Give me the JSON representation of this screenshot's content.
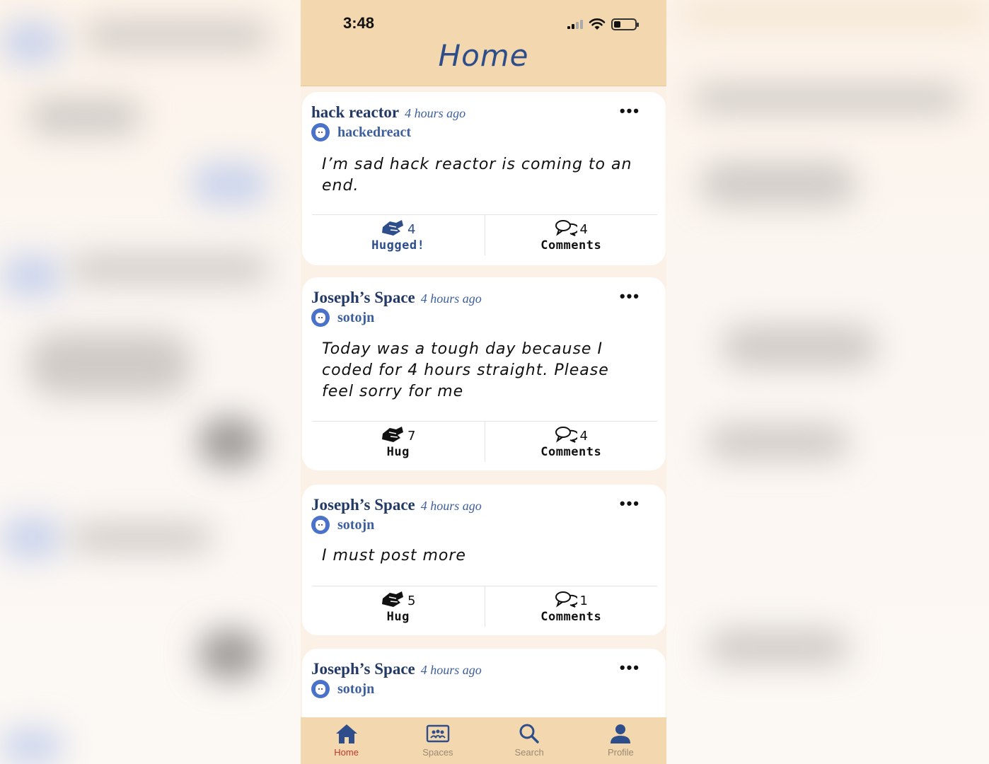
{
  "status_bar": {
    "time": "3:48"
  },
  "header": {
    "title": "Home"
  },
  "posts": [
    {
      "space": "hack reactor",
      "time_ago": "4 hours ago",
      "username": "hackedreact",
      "body": "I’m sad hack reactor is coming to an end.",
      "hug_count": "4",
      "hug_label": "Hugged!",
      "hugged": true,
      "comment_count": "4",
      "comment_label": "Comments"
    },
    {
      "space": "Joseph’s Space",
      "time_ago": "4 hours ago",
      "username": "sotojn",
      "body": "Today was a tough day because I coded for 4 hours straight. Please feel sorry for me",
      "hug_count": "7",
      "hug_label": "Hug",
      "hugged": false,
      "comment_count": "4",
      "comment_label": "Comments"
    },
    {
      "space": "Joseph’s Space",
      "time_ago": "4 hours ago",
      "username": "sotojn",
      "body": "I must post more",
      "hug_count": "5",
      "hug_label": "Hug",
      "hugged": false,
      "comment_count": "1",
      "comment_label": "Comments"
    },
    {
      "space": "Joseph’s Space",
      "time_ago": "4 hours ago",
      "username": "sotojn"
    }
  ],
  "tabbar": [
    {
      "label": "Home",
      "icon": "home-icon",
      "active": true
    },
    {
      "label": "Spaces",
      "icon": "spaces-icon",
      "active": false
    },
    {
      "label": "Search",
      "icon": "search-icon",
      "active": false
    },
    {
      "label": "Profile",
      "icon": "profile-icon",
      "active": false
    }
  ],
  "colors": {
    "header_bg": "#f3d7ae",
    "accent_blue": "#2d4e8a",
    "active_tab": "#c0392b"
  }
}
